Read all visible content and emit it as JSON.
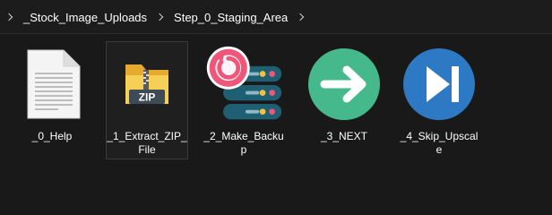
{
  "breadcrumb": {
    "items": [
      "_Stock_Image_Uploads",
      "Step_0_Staging_Area"
    ]
  },
  "files": [
    {
      "name": "_0_Help",
      "icon": "text-document-icon"
    },
    {
      "name": "_1_Extract_ZIP_File",
      "icon": "zip-folder-icon",
      "badge": "ZIP"
    },
    {
      "name": "_2_Make_Backup",
      "icon": "backup-server-icon"
    },
    {
      "name": "_3_NEXT",
      "icon": "arrow-right-circle-icon"
    },
    {
      "name": "_4_Skip_Upscale",
      "icon": "skip-forward-circle-icon"
    }
  ],
  "colors": {
    "background": "#191919",
    "next_green": "#46b98c",
    "skip_blue": "#2e79c4",
    "server_teal": "#1f5f73",
    "refresh_pink": "#f0567a",
    "folder_yellow": "#f2c94c"
  }
}
